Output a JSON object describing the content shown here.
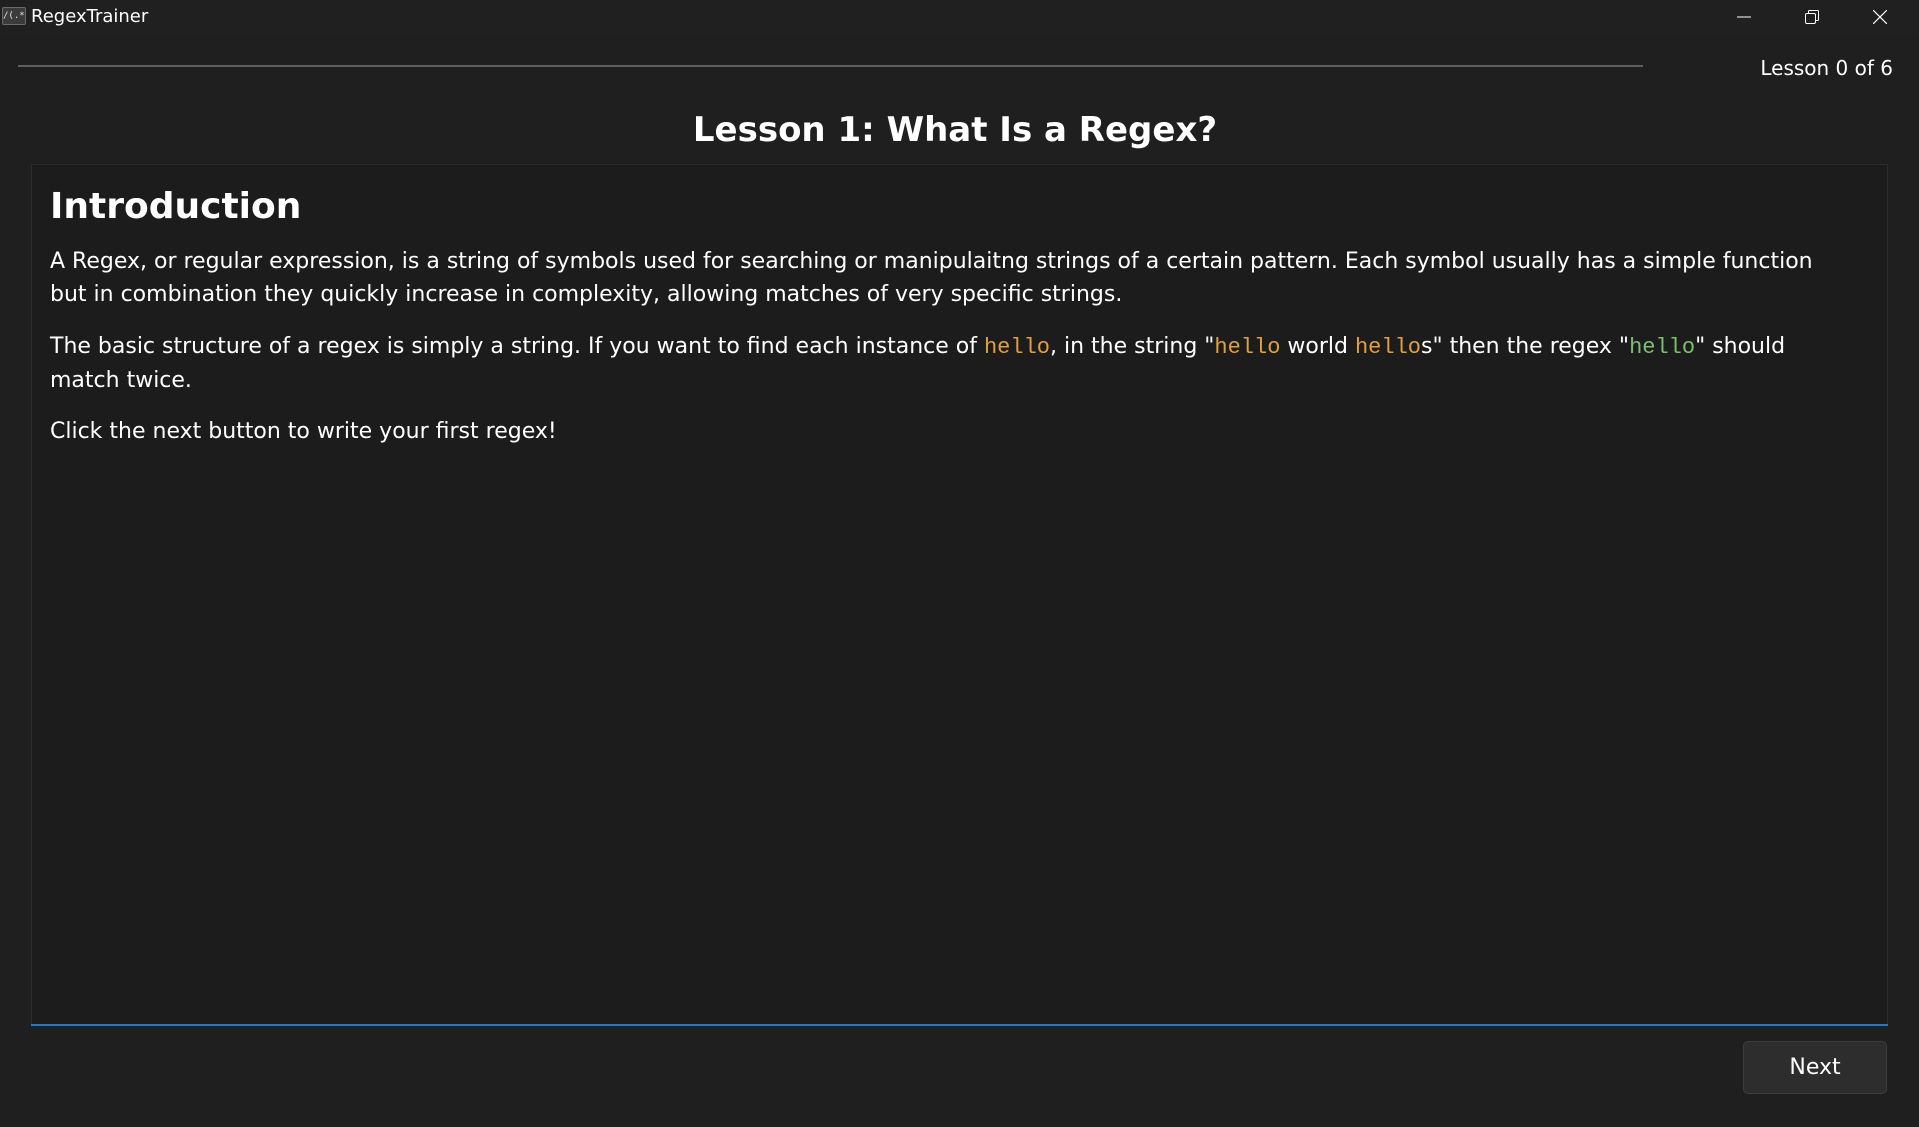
{
  "window": {
    "app_title": "RegexTrainer",
    "app_icon_glyph": "/(.*)"
  },
  "header": {
    "lesson_counter": "Lesson 0 of 6",
    "progress_fraction": 0,
    "lesson_title": "Lesson 1: What Is a Regex?"
  },
  "content": {
    "heading": "Introduction",
    "paragraph1": "A Regex, or regular expression, is a string of symbols used for searching or manipulaitng strings of a certain pattern. Each symbol usually has a simple function but in combination they quickly increase in complexity, allowing matches of very specific strings.",
    "paragraph2": {
      "part1": "The basic structure of a regex is simply a string. If you want to find each instance of ",
      "code1": "hello",
      "part2": ", in the string \"",
      "code2": "hello",
      "part3": " world ",
      "code3": "hello",
      "part4": "s\" then the regex \"",
      "code4": "hello",
      "part5": "\" should match twice."
    },
    "paragraph3": "Click the next button to write your first regex!"
  },
  "footer": {
    "next_label": "Next"
  },
  "colors": {
    "accent": "#1e7acf",
    "code_match": "#e0a040",
    "code_regex": "#7cbf6e"
  }
}
